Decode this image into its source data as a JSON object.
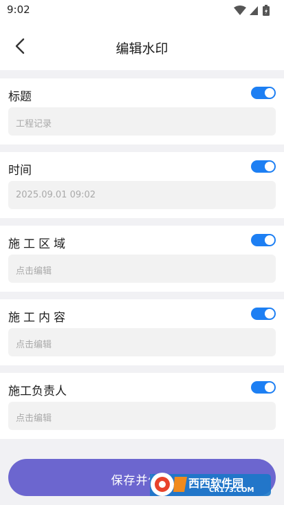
{
  "status_bar": {
    "time": "9:02",
    "icons": [
      "wifi-icon",
      "signal-icon",
      "battery-charging-icon"
    ]
  },
  "header": {
    "title": "编辑水印",
    "back_icon": "chevron-left-icon"
  },
  "accent_color": "#1d7ff3",
  "button_color": "#6c66cf",
  "sections": [
    {
      "label": "标题",
      "enabled": true,
      "value": "",
      "placeholder": "工程记录"
    },
    {
      "label": "时间",
      "enabled": true,
      "value": "",
      "placeholder": "2025.09.01 09:02"
    },
    {
      "label": "施工区域",
      "enabled": true,
      "value": "",
      "placeholder": "点击编辑"
    },
    {
      "label": "施工内容",
      "enabled": true,
      "value": "",
      "placeholder": "点击编辑"
    },
    {
      "label": "施工负责人",
      "enabled": true,
      "value": "",
      "placeholder": "点击编辑"
    }
  ],
  "save_button": {
    "label": "保存并使用"
  },
  "watermark": {
    "brand": "西西软件园",
    "url": "CR173.COM"
  }
}
